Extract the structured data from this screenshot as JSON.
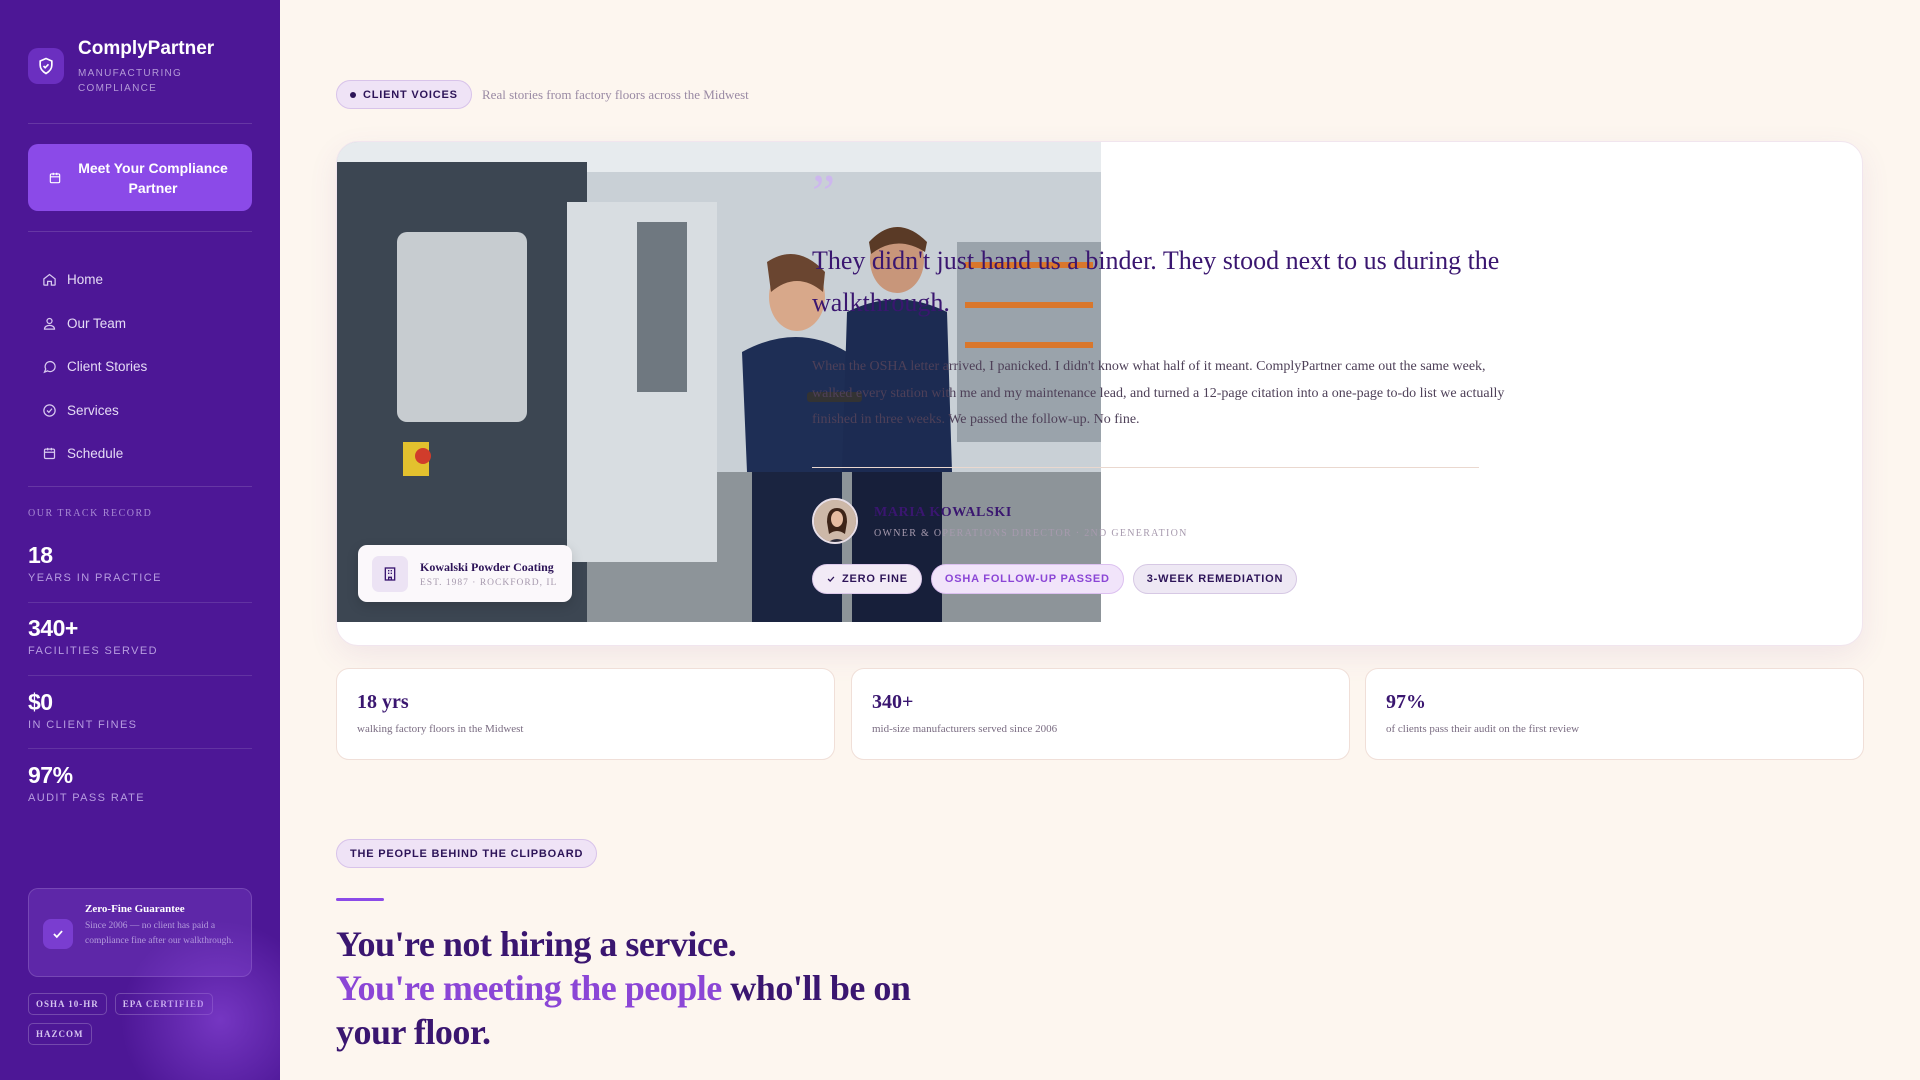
{
  "brand": {
    "name": "ComplyPartner",
    "subtitle": "MANUFACTURING COMPLIANCE"
  },
  "sidebar": {
    "cta_label": "Meet Your Compliance Partner",
    "nav": [
      {
        "label": "Home",
        "icon": "home-icon"
      },
      {
        "label": "Our Team",
        "icon": "user-icon"
      },
      {
        "label": "Client Stories",
        "icon": "chat-icon"
      },
      {
        "label": "Services",
        "icon": "check-circle-icon"
      },
      {
        "label": "Schedule",
        "icon": "calendar-icon"
      }
    ],
    "track_title": "OUR TRACK RECORD",
    "stats": [
      {
        "value": "18",
        "label": "YEARS IN PRACTICE"
      },
      {
        "value": "340+",
        "label": "FACILITIES SERVED"
      },
      {
        "value": "$0",
        "label": "IN CLIENT FINES"
      },
      {
        "value": "97%",
        "label": "AUDIT PASS RATE"
      }
    ],
    "guarantee": {
      "title": "Zero-Fine Guarantee",
      "text": "Since 2006 — no client has paid a compliance fine after our walkthrough."
    },
    "certs": [
      "OSHA 10-HR",
      "EPA CERTIFIED",
      "HAZCOM"
    ]
  },
  "voices": {
    "badge": "CLIENT VOICES",
    "subtitle": "Real stories from factory floors across the Midwest"
  },
  "testimonial": {
    "photo_caption": {
      "name": "Kowalski Powder Coating",
      "sub": "EST. 1987 · ROCKFORD, IL"
    },
    "quote_mark": "”",
    "quote": "They didn't just hand us a binder. They stood next to us during the walkthrough.",
    "body": "When the OSHA letter arrived, I panicked. I didn't know what half of it meant. ComplyPartner came out the same week, walked every station with me and my maintenance lead, and turned a 12-page citation into a one-page to-do list we actually finished in three weeks. We passed the follow-up. No fine.",
    "person": {
      "name": "MARIA KOWALSKI",
      "role": "OWNER & OPERATIONS DIRECTOR · 2ND GENERATION"
    },
    "tags": [
      "ZERO FINE",
      "OSHA FOLLOW-UP PASSED",
      "3-WEEK REMEDIATION"
    ]
  },
  "mini_stats": [
    {
      "value": "18 yrs",
      "text": "walking factory floors in the Midwest"
    },
    {
      "value": "340+",
      "text": "mid-size manufacturers served since 2006"
    },
    {
      "value": "97%",
      "text": "of clients pass their audit on the first review"
    }
  ],
  "people": {
    "badge": "THE PEOPLE BEHIND THE CLIPBOARD",
    "headline_line1": "You're not hiring a service.",
    "headline_highlight": "You're meeting the people",
    "headline_rest": " who'll be on your floor."
  },
  "colors": {
    "sidebar": "#4d1796",
    "accent": "#8b4ae8",
    "ink": "#3a1670",
    "page": "#fdf6ef"
  }
}
